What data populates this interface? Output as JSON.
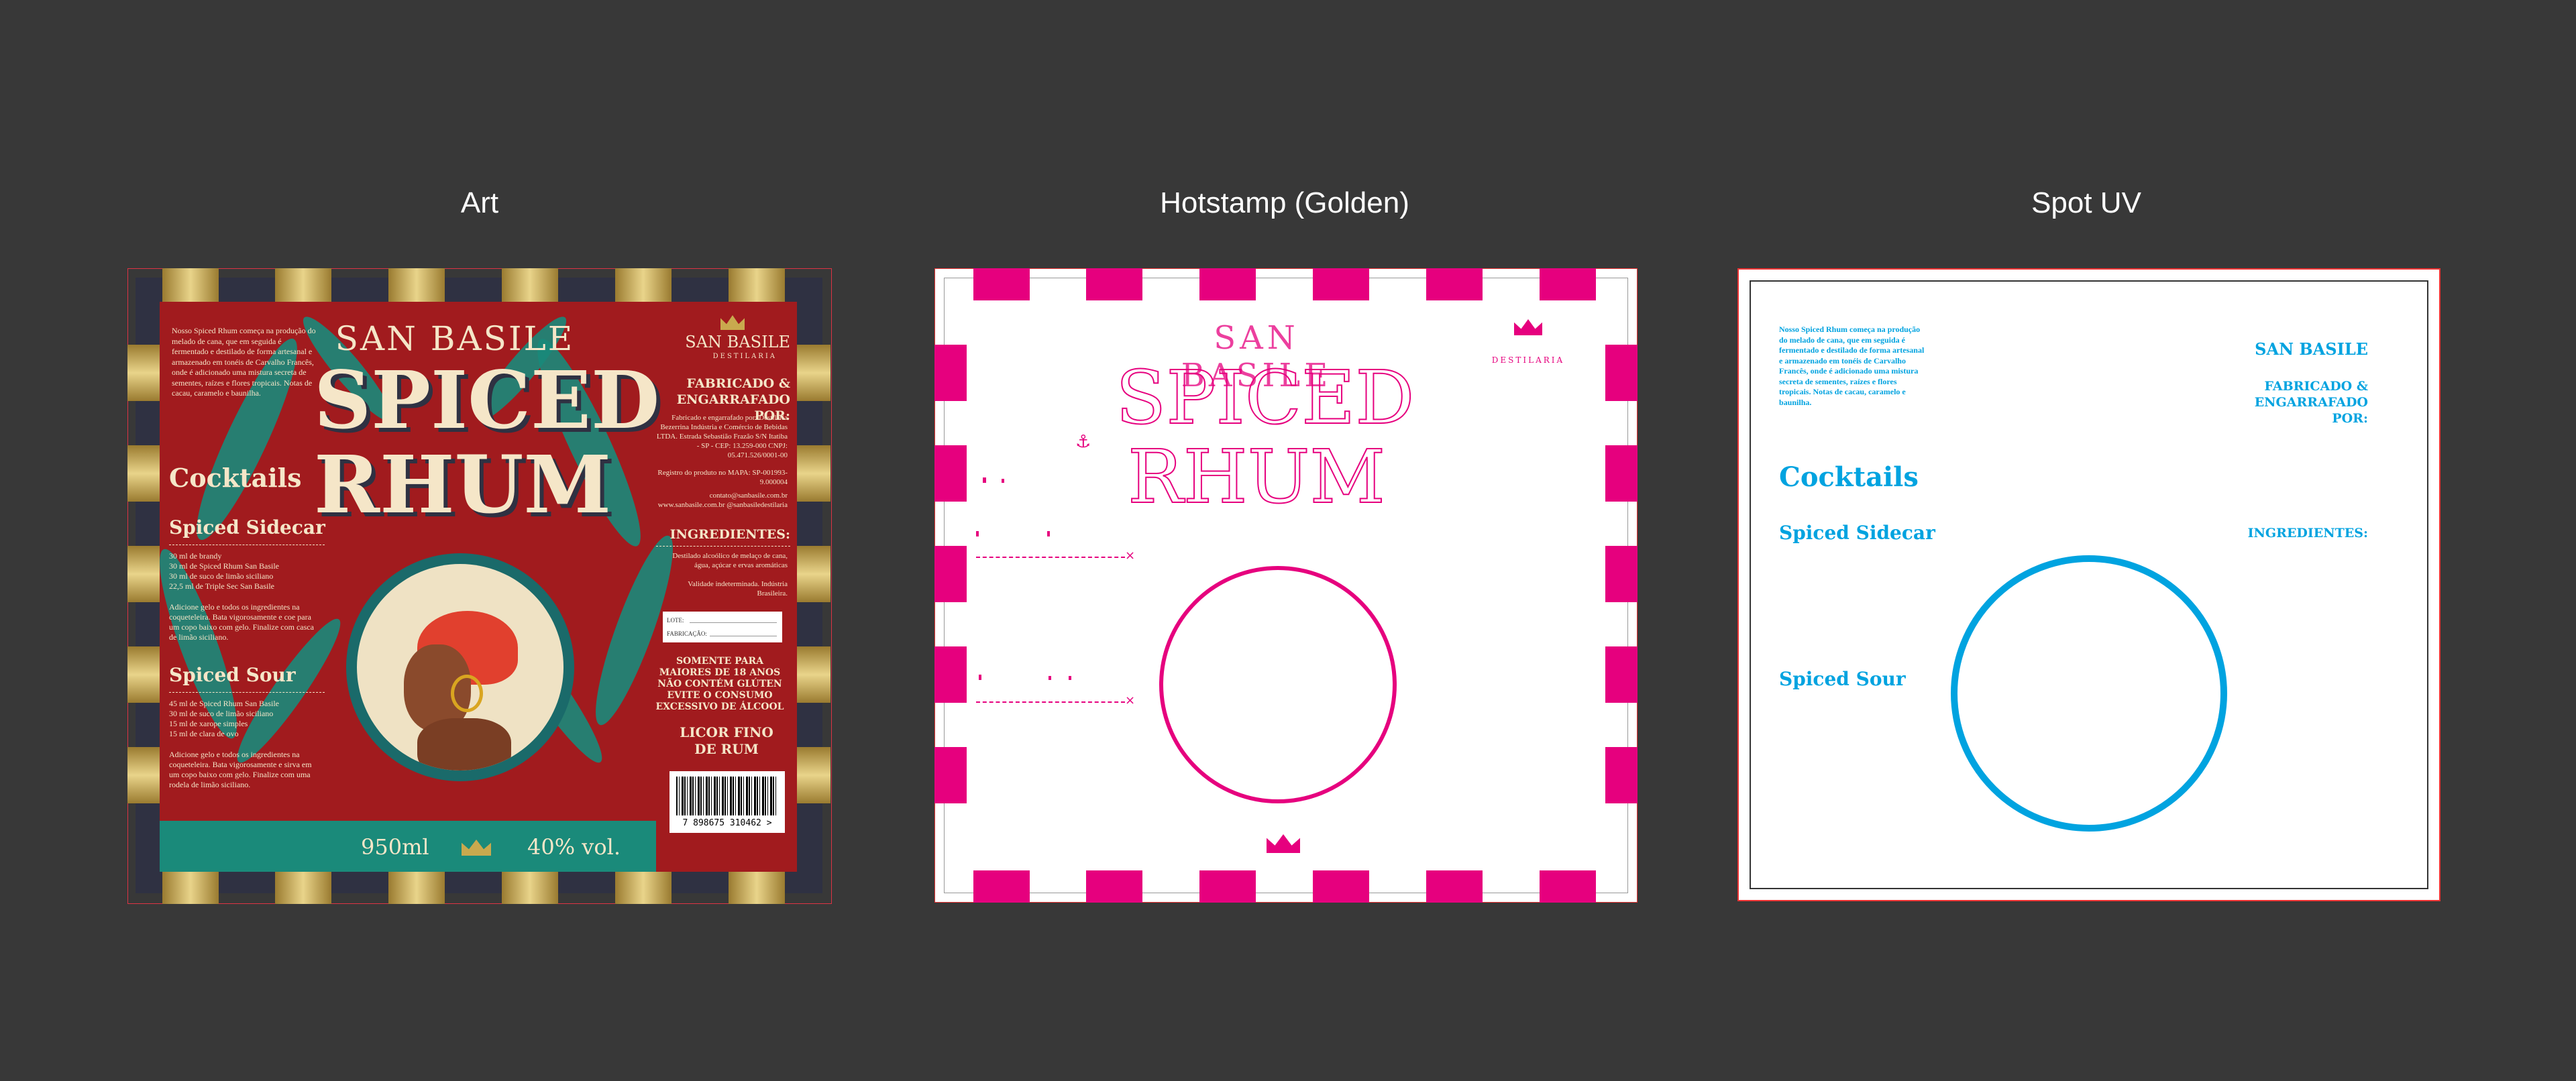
{
  "panels": {
    "art": "Art",
    "hotstamp": "Hotstamp (Golden)",
    "spotuv": "Spot UV"
  },
  "brand": {
    "name": "SAN BASILE",
    "product_line1": "SPICED",
    "product_line2": "RHUM",
    "logo_name": "SAN BASILE",
    "logo_sub": "DESTILARIA"
  },
  "story": "Nosso Spiced Rhum começa na produção do melado de cana, que em seguida é fermentado e destilado de forma artesanal e armazenado em tonéis de Carvalho Francês, onde é adicionado uma mistura secreta de sementes, raízes e flores tropicais. Notas de cacau, caramelo e baunilha.",
  "cocktails": {
    "title": "Cocktails",
    "sidecar": {
      "title": "Spiced Sidecar",
      "ingredients": [
        "30 ml de brandy",
        "30 ml de Spiced Rhum San Basile",
        "30 ml de suco de limão siciliano",
        "22,5 ml de Triple Sec San Basile"
      ],
      "method": "Adicione gelo e todos os ingredientes na coqueteleira. Bata vigorosamente e coe para um copo baixo com gelo. Finalize com casca de limão siciliano."
    },
    "sour": {
      "title": "Spiced Sour",
      "ingredients": [
        "45 ml de Spiced Rhum San Basile",
        "30 ml de suco de limão siciliano",
        "15 ml de xarope simples",
        "15 ml de clara de ovo"
      ],
      "method": "Adicione gelo e todos os ingredientes na coqueteleira. Bata vigorosamente e sirva em um copo baixo com gelo. Finalize com uma rodela de limão siciliano."
    }
  },
  "right": {
    "made_by_title": "FABRICADO & ENGARRAFADO POR:",
    "made_by_text": "Fabricado e engarrafado por: Destilaria Bezerrina Indústria e Comércio de Bebidas LTDA. Estrada Sebastião Frazão S/N Itatiba - SP - CEP: 13.259-000 CNPJ: 05.471.526/0001-00",
    "registry": "Registro do produto no MAPA: SP-001993-9.000004",
    "contact": "contato@sanbasile.com.br www.sanbasile.com.br @sanbasiledestilaria",
    "ingredients_title": "INGREDIENTES:",
    "ingredients_text": "Destilado alcoólico de melaço de cana, água, açúcar e ervas aromáticas",
    "validity": "Validade indeterminada. Indústria Brasileira.",
    "lote": "LOTE:",
    "fabricacao": "FABRICAÇÃO:",
    "warning": "SOMENTE PARA MAIORES DE 18 ANOS NÃO CONTÉM GLÚTEN EVITE O CONSUMO EXCESSIVO DE ÁLCOOL",
    "liquor": "LICOR FINO DE RUM",
    "barcode": "7 898675 310462 >"
  },
  "footer": {
    "volume": "950ml",
    "abv": "40% vol."
  },
  "colors": {
    "background": "#383838",
    "label_red": "#a11b1e",
    "teal": "#1a8a7a",
    "gold": "#c9a94e",
    "hotstamp_magenta": "#e6007e",
    "spotuv_cyan": "#00a3e0",
    "cream": "#f5e6c8"
  }
}
